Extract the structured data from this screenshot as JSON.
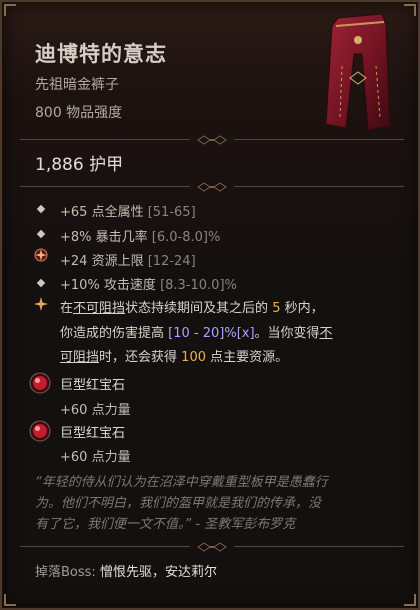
{
  "item": {
    "name": "迪博特的意志",
    "type": "先祖暗金裤子",
    "power": "800 物品强度",
    "armor": "1,886 护甲",
    "image": "pants-icon"
  },
  "affixes": [
    {
      "text": "+65 点全属性",
      "range": "[51-65]"
    },
    {
      "text": "+8% 暴击几率",
      "range": "[6.0-8.0]%"
    },
    {
      "text": "+24 资源上限",
      "range": "[12-24]"
    },
    {
      "text": "+10% 攻击速度",
      "range": "[8.3-10.0]%"
    }
  ],
  "legendary": {
    "line1": {
      "p1": "在",
      "u1": "不可阻挡",
      "p2": "状态持续期间及其之后的",
      "n1": "5",
      "p3": "秒内，"
    },
    "line2": {
      "p1": "你造成的伤害提高",
      "range": "[10 - 20]%[x]",
      "p2": "。当你变得",
      "u1": "不"
    },
    "line3": {
      "u1": "可阻挡",
      "p1": "时，还会获得",
      "n1": "100",
      "p2": "点主要资源。"
    }
  },
  "sockets": [
    {
      "name": "巨型红宝石",
      "stat": "+60 点力量",
      "icon": "ruby-gem-icon"
    },
    {
      "name": "巨型红宝石",
      "stat": "+60 点力量",
      "icon": "ruby-gem-icon"
    }
  ],
  "flavor": {
    "line1": "“年轻的侍从们认为在沼泽中穿戴重型板甲是愚蠢行",
    "line2": "为。他们不明白，我们的盔甲就是我们的传承，没",
    "line3": "有了它，我们便一文不值。” - 圣教军彭布罗克"
  },
  "drop": {
    "label": "掉落Boss:",
    "bosses": "憎恨先驱，安达莉尔"
  },
  "colors": {
    "legendary_highlight": "#e8b24a",
    "range_highlight": "#a8a3ff",
    "gem_red": "#c0202e"
  }
}
